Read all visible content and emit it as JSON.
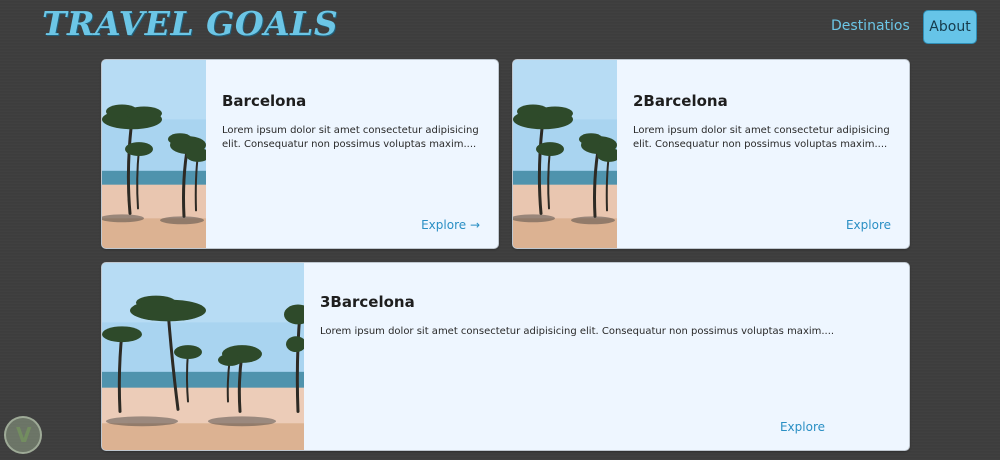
{
  "header": {
    "logo": "TRAVEL GOALS",
    "nav": {
      "destinations": "Destinatios",
      "about": "About"
    }
  },
  "cards": [
    {
      "title": "Barcelona",
      "text": "Lorem ipsum dolor sit amet consectetur adipisicing elit. Consequatur non possimus voluptas maxim....",
      "link": "Explore →"
    },
    {
      "title": "2Barcelona",
      "text": "Lorem ipsum dolor sit amet consectetur adipisicing elit. Consequatur non possimus voluptas maxim....",
      "link": "Explore"
    },
    {
      "title": "3Barcelona",
      "text": "Lorem ipsum dolor sit amet consectetur adipisicing elit. Consequatur non possimus voluptas maxim....",
      "link": "Explore"
    }
  ],
  "colors": {
    "accent": "#6cc6e6",
    "link": "#2a8fc4",
    "card_bg": "#eef6ff",
    "page_bg": "#3e3e3e"
  },
  "icons": {
    "badge": "v-shield-icon"
  }
}
